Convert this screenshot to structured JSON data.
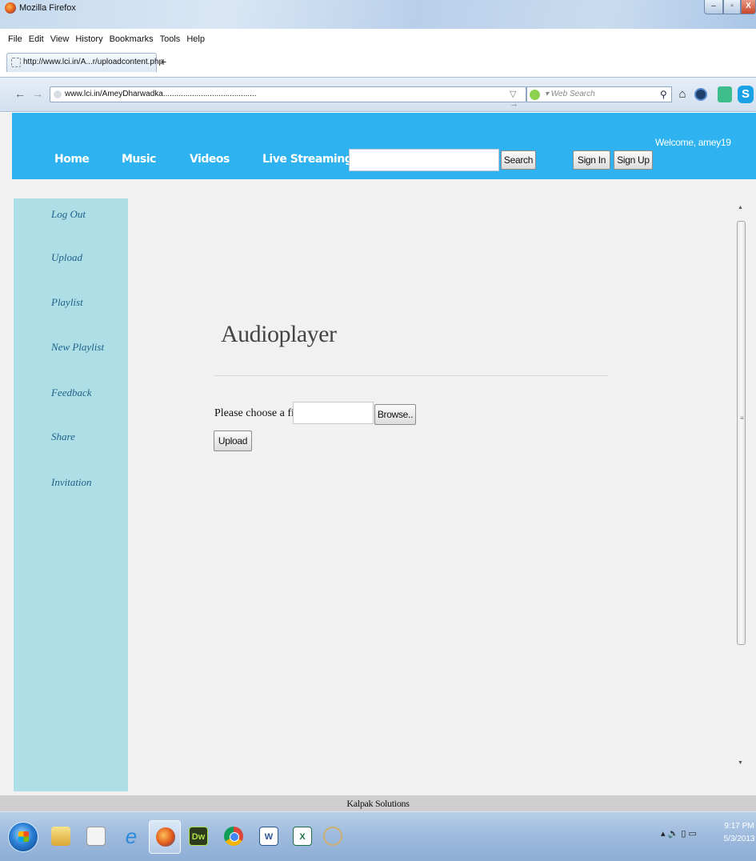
{
  "window": {
    "title": "Mozilla Firefox",
    "controls": {
      "minimize": "–",
      "maximize": "▫",
      "close": "X"
    }
  },
  "menubar": [
    "File",
    "Edit",
    "View",
    "History",
    "Bookmarks",
    "Tools",
    "Help"
  ],
  "tabs": [
    {
      "label": "http://www.lci.in/A...r/uploadcontent.php"
    }
  ],
  "new_tab": "+",
  "navbar": {
    "back": "←",
    "forward": "→",
    "url": "www.lci.in/AmeyDharwadka..........................................",
    "go": "▽ →",
    "search_placeholder": "▾ Web Search",
    "search_glyph": "⚲",
    "icons": [
      "home-icon",
      "sync-icon",
      "addon-icon",
      "skype-icon"
    ]
  },
  "site": {
    "nav": [
      "Home",
      "Music",
      "Videos",
      "Live Streaming"
    ],
    "search_button": "Search",
    "search_value": "",
    "signin": "Sign In",
    "signup": "Sign Up",
    "welcome": "Welcome, amey19",
    "colors": {
      "header": "#2fb3f0",
      "sidebar": "#aedfe6",
      "link": "#1f5f8a"
    }
  },
  "sidebar": {
    "items": [
      "Log Out",
      "Upload",
      "Playlist",
      "New Playlist",
      "Feedback",
      "Share",
      "Invitation"
    ]
  },
  "main": {
    "heading": "Audioplayer",
    "file_label": "Please choose a file:",
    "file_value": "",
    "browse": "Browse..",
    "upload": "Upload"
  },
  "footer": {
    "text": "Kalpak Solutions"
  },
  "taskbar": {
    "apps": [
      "windows-explorer",
      "document-app",
      "internet-explorer",
      "firefox",
      "dreamweaver",
      "chrome",
      "word",
      "excel",
      "paint"
    ],
    "app_labels": {
      "dw": "Dw",
      "word": "W",
      "excel": "X"
    },
    "tray": "▴ 🔈 ▯ ▭",
    "time": "9:17 PM",
    "date": "5/3/2013"
  }
}
